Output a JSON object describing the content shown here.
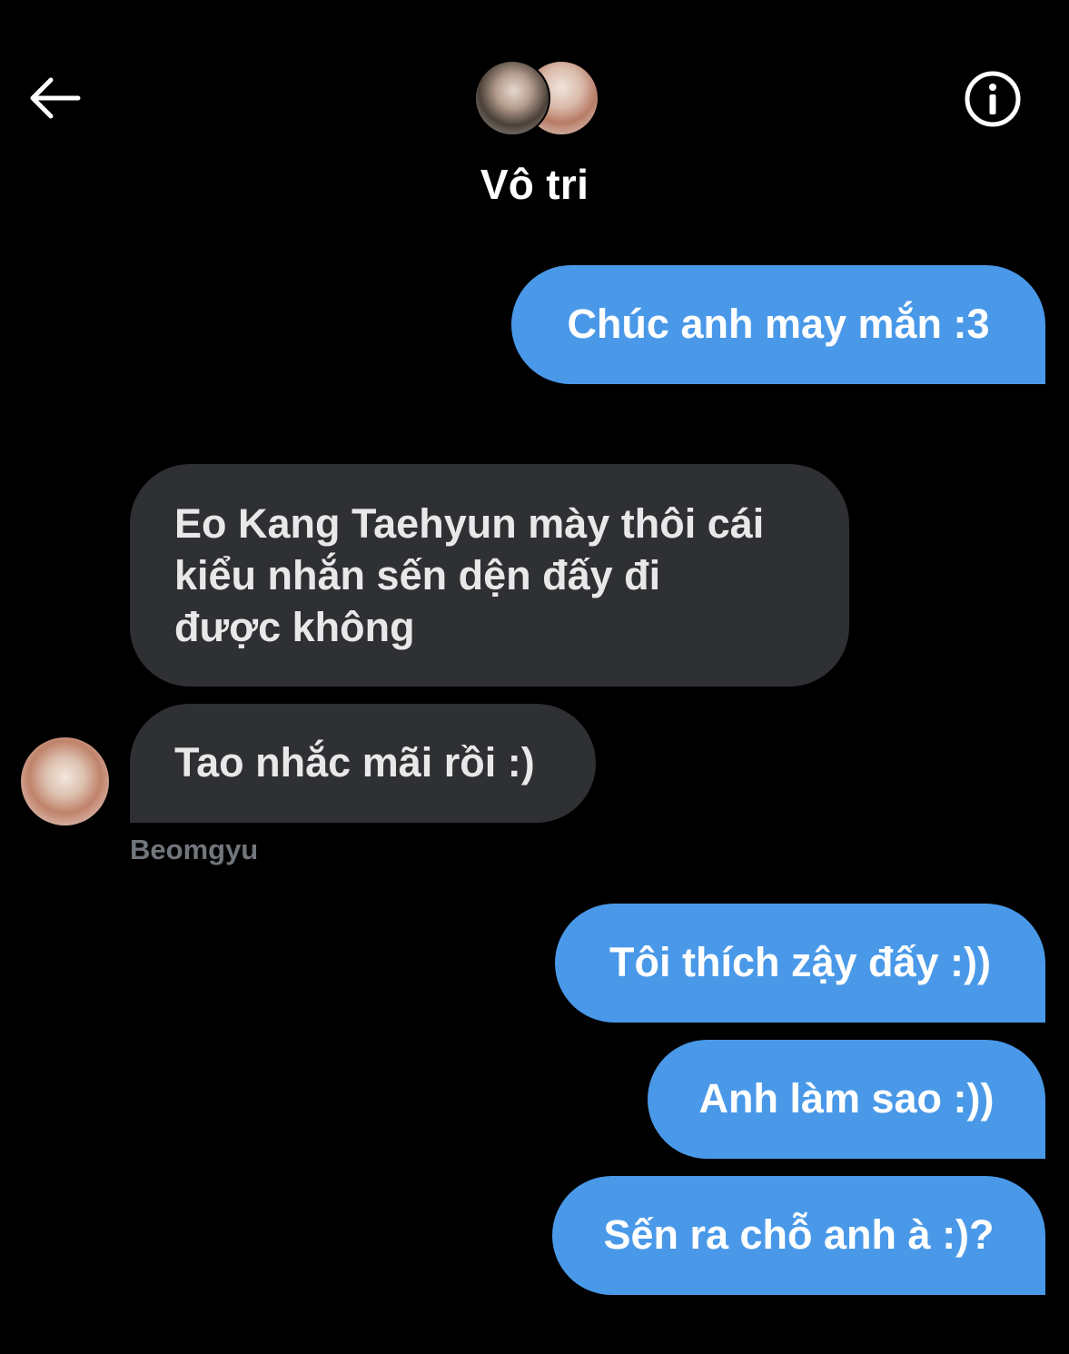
{
  "header": {
    "title": "Vô tri",
    "back_icon": "arrow-left-icon",
    "info_icon": "info-circle-icon"
  },
  "messages": [
    {
      "direction": "outgoing",
      "text": "Chúc anh may mắn :3"
    },
    {
      "direction": "incoming",
      "lines": [
        "Eo Kang Taehyun mày thôi cái",
        "kiểu nhắn sến dện đấy đi",
        "được không"
      ]
    },
    {
      "direction": "incoming",
      "text": "Tao nhắc mãi rồi :)",
      "sender": "Beomgyu"
    },
    {
      "direction": "outgoing",
      "text": "Tôi thích zậy đấy :))"
    },
    {
      "direction": "outgoing",
      "text": "Anh làm sao :))"
    },
    {
      "direction": "outgoing",
      "text": "Sến ra chỗ anh à :)?"
    }
  ],
  "colors": {
    "background": "#000000",
    "outgoing_bubble": "#4a99e9",
    "incoming_bubble": "#2f3033",
    "sender_name": "#71767b"
  }
}
